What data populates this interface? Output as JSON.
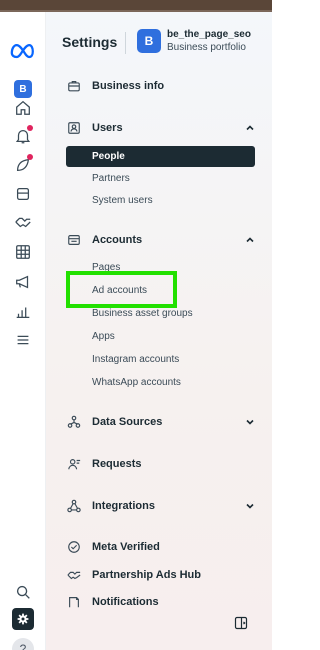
{
  "header": {
    "title": "Settings",
    "portfolio_initial": "B",
    "portfolio_name": "be_the_page_seo",
    "portfolio_sub": "Business portfolio"
  },
  "rail": {
    "avatar_initial": "B",
    "help_label": "?",
    "icons": [
      "meta-logo",
      "home-icon",
      "notifications-icon",
      "activity-icon",
      "pages-icon",
      "partnerships-icon",
      "table-icon",
      "ads-icon",
      "analytics-icon",
      "menu-icon",
      "search-icon",
      "gear-icon",
      "help-icon"
    ]
  },
  "nav": {
    "business_info": "Business info",
    "users": {
      "label": "Users",
      "items": [
        "People",
        "Partners",
        "System users"
      ],
      "active": "People"
    },
    "accounts": {
      "label": "Accounts",
      "items": [
        "Pages",
        "Ad accounts",
        "Business asset groups",
        "Apps",
        "Instagram accounts",
        "WhatsApp accounts"
      ]
    },
    "data_sources": "Data Sources",
    "requests": "Requests",
    "integrations": "Integrations",
    "meta_verified": "Meta Verified",
    "partnership_ads_hub": "Partnership Ads Hub",
    "notifications": "Notifications"
  },
  "colors": {
    "accent": "#2f6fde",
    "highlight": "#22e000",
    "active_bg": "#1c2b33",
    "badge": "#e0245e"
  }
}
